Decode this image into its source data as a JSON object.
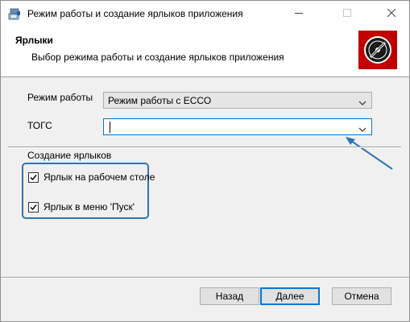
{
  "window": {
    "title": "Режим работы и создание ярлыков приложения",
    "controls": [
      "minimize-icon",
      "maximize-icon",
      "close-icon"
    ]
  },
  "header": {
    "title": "Ярлыки",
    "subtitle": "Выбор режима работы и создание ярлыков приложения",
    "logo_color": "#c00000"
  },
  "form": {
    "mode_label": "Режим работы",
    "mode_value": "Режим работы с ЕССО",
    "togs_label": "ТОГС",
    "togs_value": ""
  },
  "shortcuts": {
    "group_label": "Создание ярлыков",
    "items": [
      {
        "label": "Ярлык на рабочем столе",
        "checked": true
      },
      {
        "label": "Ярлык в меню 'Пуск'",
        "checked": true
      }
    ]
  },
  "buttons": {
    "back": "Назад",
    "next": "Далее",
    "cancel": "Отмена"
  },
  "colors": {
    "accent": "#0078d7",
    "annotation": "#2e75b6"
  }
}
